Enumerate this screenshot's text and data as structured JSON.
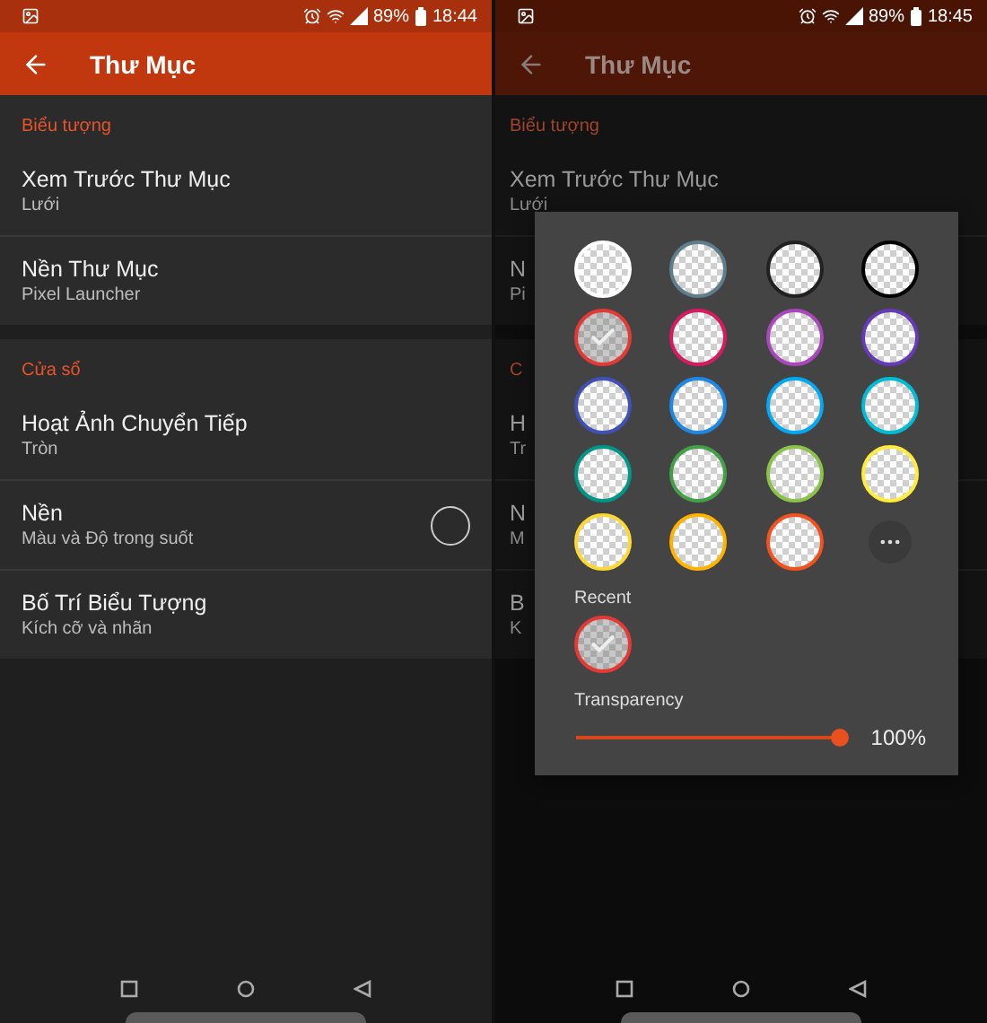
{
  "screens": [
    {
      "status_bar": {
        "battery": "89%",
        "time": "18:44"
      },
      "app_bar": {
        "title": "Thư Mục"
      },
      "dimmed": false,
      "sections": [
        {
          "title": "Biểu tượng",
          "items": [
            {
              "kind": "text",
              "title": "Xem Trước Thư Mục",
              "subtitle": "Lưới"
            },
            {
              "kind": "text",
              "title": "Nền Thư Mục",
              "subtitle": "Pixel Launcher"
            }
          ]
        },
        {
          "title": "Cửa sổ",
          "items": [
            {
              "kind": "text",
              "title": "Hoạt Ảnh Chuyển Tiếp",
              "subtitle": "Tròn"
            },
            {
              "kind": "color",
              "title": "Nền",
              "subtitle": "Màu và Độ trong suốt"
            },
            {
              "kind": "text",
              "title": "Bố Trí Biểu Tượng",
              "subtitle": "Kích cỡ và nhãn"
            }
          ]
        }
      ]
    },
    {
      "status_bar": {
        "battery": "89%",
        "time": "18:45"
      },
      "app_bar": {
        "title": "Thư Mục"
      },
      "dimmed": true,
      "sections": [
        {
          "title": "Biểu tượng",
          "items": [
            {
              "kind": "text",
              "title": "Xem Trước Thư Mục",
              "subtitle": "Lưới"
            },
            {
              "kind": "text",
              "title": "N",
              "subtitle": "Pi"
            }
          ]
        },
        {
          "title": "C",
          "items": [
            {
              "kind": "text",
              "title": "H",
              "subtitle": "Tr"
            },
            {
              "kind": "text",
              "title": "N",
              "subtitle": "M"
            },
            {
              "kind": "text",
              "title": "B",
              "subtitle": "K"
            }
          ]
        }
      ],
      "color_dialog": {
        "swatches": [
          {
            "color": "#ffffff",
            "selected": false
          },
          {
            "color": "#607d8b",
            "selected": false
          },
          {
            "color": "#212121",
            "selected": false
          },
          {
            "color": "#000000",
            "selected": false
          },
          {
            "color": "#e53935",
            "selected": true
          },
          {
            "color": "#d81b60",
            "selected": false
          },
          {
            "color": "#ab47bc",
            "selected": false
          },
          {
            "color": "#673ab7",
            "selected": false
          },
          {
            "color": "#3f51b5",
            "selected": false
          },
          {
            "color": "#1e88e5",
            "selected": false
          },
          {
            "color": "#03a9f4",
            "selected": false
          },
          {
            "color": "#00bcd4",
            "selected": false
          },
          {
            "color": "#009688",
            "selected": false
          },
          {
            "color": "#43a047",
            "selected": false
          },
          {
            "color": "#8bc34a",
            "selected": false
          },
          {
            "color": "#ffeb3b",
            "selected": false
          },
          {
            "color": "#fdd835",
            "selected": false
          },
          {
            "color": "#ffb300",
            "selected": false
          },
          {
            "color": "#f4511e",
            "selected": false
          }
        ],
        "recent_label": "Recent",
        "recent": [
          {
            "color": "#e53935",
            "selected": true
          }
        ],
        "transparency": {
          "label": "Transparency",
          "level": 1,
          "reading": "100%"
        }
      }
    }
  ]
}
